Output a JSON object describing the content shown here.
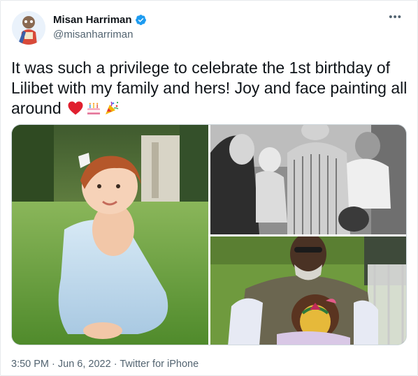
{
  "author": {
    "name": "Misan Harriman",
    "handle": "@misanharriman",
    "verified": true,
    "avatar_icon": "illustrated-avatar-icon"
  },
  "more_icon": "more-options-icon",
  "tweet": {
    "text": "It was such a privilege to celebrate the 1st birthday of Lilibet with my family and hers! Joy and face painting all around",
    "emojis": [
      "red-heart-emoji",
      "birthday-cake-emoji",
      "party-popper-emoji"
    ]
  },
  "media": [
    {
      "name": "photo-baby-on-grass"
    },
    {
      "name": "photo-family-black-and-white"
    },
    {
      "name": "photo-man-and-child-face-paint"
    }
  ],
  "meta": {
    "time": "3:50 PM",
    "sep1": " · ",
    "date": "Jun 6, 2022",
    "sep2": " · ",
    "source": "Twitter for iPhone"
  },
  "colors": {
    "verified_blue": "#1d9bf0",
    "secondary_text": "#536471",
    "primary_text": "#0f1419"
  }
}
